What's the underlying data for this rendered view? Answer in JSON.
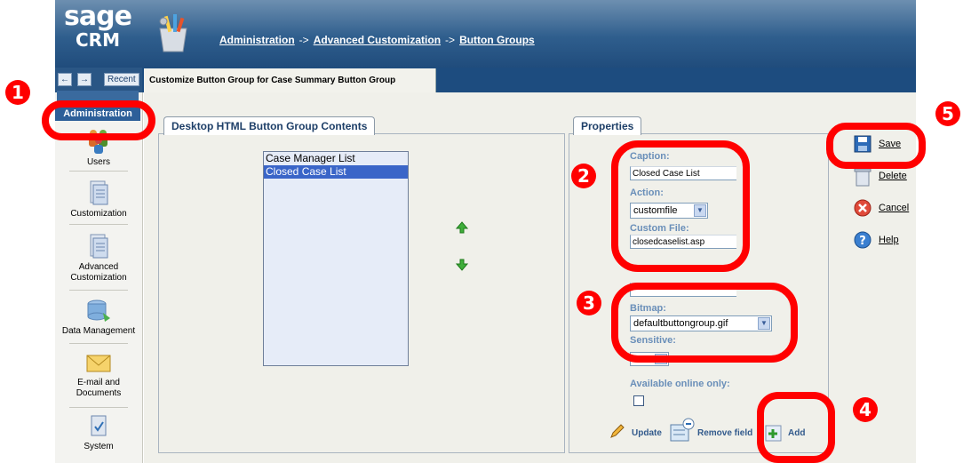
{
  "app": {
    "logo_top": "sage",
    "logo_bottom": "CRM"
  },
  "breadcrumb": {
    "items": [
      "Administration",
      "Advanced Customization",
      "Button Groups"
    ],
    "separator": "->"
  },
  "nav": {
    "back_glyph": "←",
    "forward_glyph": "→",
    "recent_label": "Recent"
  },
  "page_title": "Customize Button Group for Case Summary Button Group",
  "sidebar": {
    "selected": "Administration",
    "items": [
      {
        "label": "Users",
        "icon": "users-icon"
      },
      {
        "label": "Customization",
        "icon": "document-icon"
      },
      {
        "label": "Advanced Customization",
        "icon": "advanced-document-icon"
      },
      {
        "label": "Data Management",
        "icon": "database-icon"
      },
      {
        "label": "E-mail and Documents",
        "icon": "envelope-icon"
      },
      {
        "label": "System",
        "icon": "system-icon"
      }
    ]
  },
  "contents_panel": {
    "title": "Desktop HTML Button Group Contents",
    "list_items": [
      "Case Manager List",
      "Closed Case List"
    ],
    "selected_index": 1
  },
  "properties_panel": {
    "title": "Properties",
    "caption_label": "Caption:",
    "caption_value": "Closed Case List",
    "action_label": "Action:",
    "action_value": "customfile",
    "custom_file_label": "Custom File:",
    "custom_file_value": "closedcaselist.asp",
    "bitmap_label": "Bitmap:",
    "bitmap_value": "defaultbuttongroup.gif",
    "sensitive_label": "Sensitive:",
    "available_label": "Available online only:",
    "update_label": "Update",
    "remove_label": "Remove field",
    "add_label": "Add"
  },
  "right_buttons": [
    "Save",
    "Delete",
    "Cancel",
    "Help"
  ],
  "annotations": [
    "1",
    "2",
    "3",
    "4",
    "5"
  ],
  "colors": {
    "annotation_red": "#ff0000",
    "header_blue": "#2f5e8d",
    "selection_blue": "#3a65c8"
  }
}
